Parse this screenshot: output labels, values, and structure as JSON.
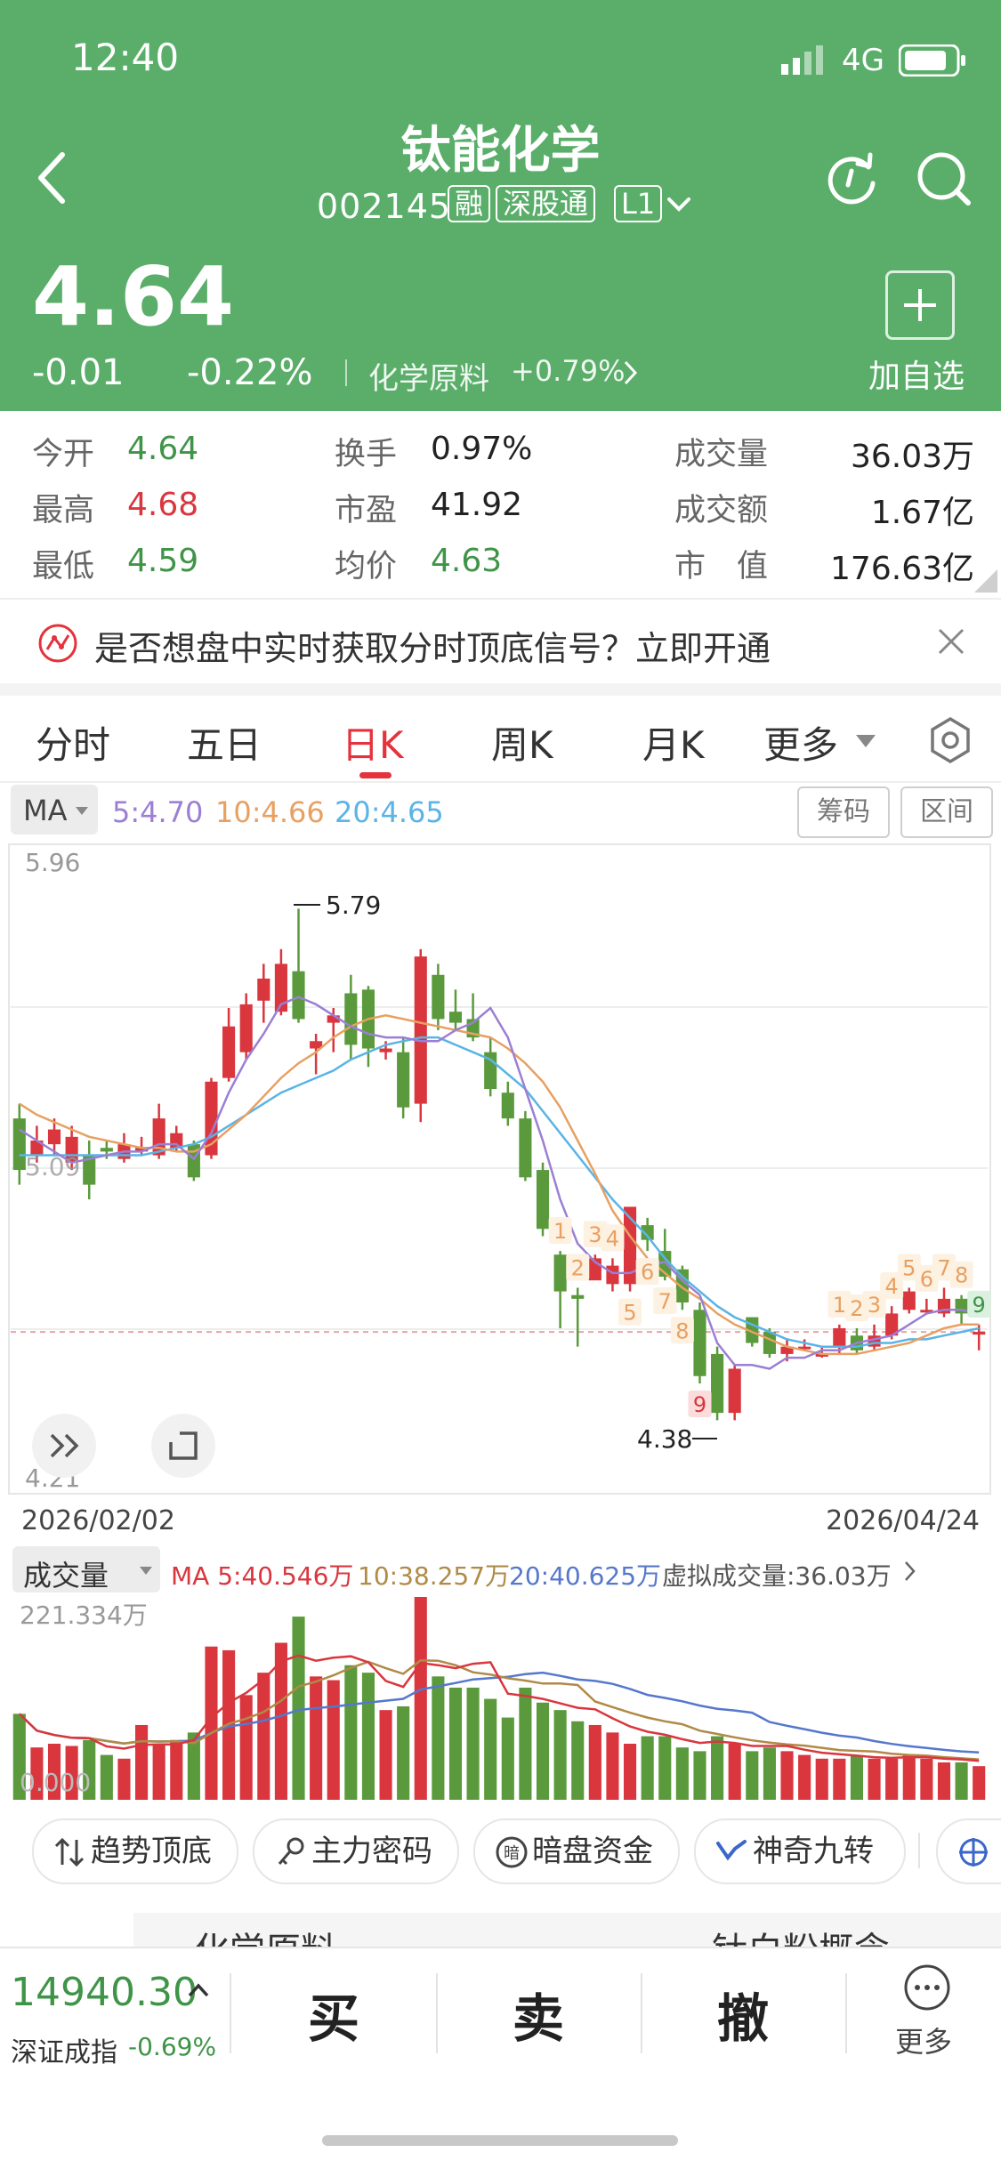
{
  "status_bar": {
    "time": "12:40",
    "network": "4G"
  },
  "stock": {
    "name": "钛能化学",
    "code": "002145",
    "tags": [
      "融",
      "深股通",
      "L1"
    ],
    "price": "4.64",
    "change": "-0.01",
    "change_pct": "-0.22%",
    "sector_name": "化学原料",
    "sector_change": "+0.79%",
    "add_watch_label": "加自选"
  },
  "stats": [
    {
      "label": "今开",
      "value": "4.64"
    },
    {
      "label": "换手",
      "value": "0.97%"
    },
    {
      "label": "成交量",
      "value": "36.03万"
    },
    {
      "label": "最高",
      "value": "4.68"
    },
    {
      "label": "市盈",
      "value": "41.92"
    },
    {
      "label": "成交额",
      "value": "1.67亿"
    },
    {
      "label": "最低",
      "value": "4.59"
    },
    {
      "label": "均价",
      "value": "4.63"
    },
    {
      "label": "市　值",
      "value": "176.63亿"
    }
  ],
  "banner": {
    "text": "是否想盘中实时获取分时顶底信号？立即开通"
  },
  "tabs": [
    "分时",
    "五日",
    "日K",
    "周K",
    "月K",
    "更多"
  ],
  "active_tab": "日K",
  "ma_legend": {
    "selector": "MA",
    "ma5": "5:4.70",
    "ma10": "10:4.66",
    "ma20": "20:4.65",
    "chip_btn": "筹码",
    "range_btn": "区间"
  },
  "colors": {
    "up": "#d9363e",
    "down": "#5b9a3c",
    "header_bg": "#5aae6a",
    "ma5": "#9b7fd4",
    "ma10": "#e8a062",
    "ma20": "#5ab4e6"
  },
  "chart_data": {
    "type": "candlestick",
    "ylim": [
      4.21,
      5.96
    ],
    "date_start": "2026/02/02",
    "date_end": "2026/04/24",
    "y_top_label": "5.96",
    "y_bottom_label": "4.21",
    "left_label": "5.09",
    "high_label": "5.79",
    "low_label": "4.38",
    "candles": [
      [
        5.22,
        5.08,
        5.26,
        5.04
      ],
      [
        5.12,
        5.16,
        5.2,
        5.1
      ],
      [
        5.15,
        5.19,
        5.22,
        5.12
      ],
      [
        5.1,
        5.17,
        5.2,
        5.08
      ],
      [
        5.12,
        5.04,
        5.16,
        5.0
      ],
      [
        5.14,
        5.13,
        5.16,
        5.11
      ],
      [
        5.11,
        5.15,
        5.18,
        5.1
      ],
      [
        5.13,
        5.14,
        5.17,
        5.12
      ],
      [
        5.12,
        5.22,
        5.26,
        5.11
      ],
      [
        5.14,
        5.18,
        5.2,
        5.13
      ],
      [
        5.15,
        5.06,
        5.16,
        5.05
      ],
      [
        5.12,
        5.32,
        5.33,
        5.11
      ],
      [
        5.33,
        5.47,
        5.52,
        5.32
      ],
      [
        5.4,
        5.53,
        5.56,
        5.38
      ],
      [
        5.54,
        5.6,
        5.64,
        5.48
      ],
      [
        5.51,
        5.64,
        5.68,
        5.5
      ],
      [
        5.62,
        5.49,
        5.79,
        5.48
      ],
      [
        5.41,
        5.43,
        5.45,
        5.34
      ],
      [
        5.48,
        5.5,
        5.52,
        5.4
      ],
      [
        5.56,
        5.42,
        5.61,
        5.38
      ],
      [
        5.57,
        5.41,
        5.58,
        5.36
      ],
      [
        5.4,
        5.41,
        5.43,
        5.38
      ],
      [
        5.4,
        5.25,
        5.44,
        5.22
      ],
      [
        5.26,
        5.66,
        5.68,
        5.21
      ],
      [
        5.61,
        5.49,
        5.64,
        5.46
      ],
      [
        5.51,
        5.48,
        5.57,
        5.46
      ],
      [
        5.49,
        5.44,
        5.56,
        5.43
      ],
      [
        5.4,
        5.3,
        5.44,
        5.28
      ],
      [
        5.29,
        5.22,
        5.32,
        5.2
      ],
      [
        5.22,
        5.06,
        5.24,
        5.05
      ],
      [
        5.08,
        4.92,
        5.1,
        4.9
      ],
      [
        4.85,
        4.75,
        4.86,
        4.65
      ],
      [
        4.74,
        4.73,
        4.76,
        4.6
      ],
      [
        4.78,
        4.84,
        4.85,
        4.79
      ],
      [
        4.77,
        4.82,
        4.84,
        4.75
      ],
      [
        4.77,
        4.98,
        4.98,
        4.75
      ],
      [
        4.93,
        4.89,
        4.95,
        4.86
      ],
      [
        4.86,
        4.79,
        4.92,
        4.78
      ],
      [
        4.81,
        4.72,
        4.82,
        4.7
      ],
      [
        4.7,
        4.52,
        4.72,
        4.5
      ],
      [
        4.58,
        4.42,
        4.6,
        4.4
      ],
      [
        4.42,
        4.54,
        4.55,
        4.4
      ],
      [
        4.68,
        4.61,
        4.68,
        4.6
      ],
      [
        4.64,
        4.58,
        4.65,
        4.57
      ],
      [
        4.58,
        4.6,
        4.62,
        4.56
      ],
      [
        4.6,
        4.6,
        4.62,
        4.59
      ],
      [
        4.58,
        4.58,
        4.6,
        4.57
      ],
      [
        4.6,
        4.65,
        4.66,
        4.58
      ],
      [
        4.63,
        4.59,
        4.65,
        4.58
      ],
      [
        4.6,
        4.63,
        4.66,
        4.59
      ],
      [
        4.63,
        4.69,
        4.71,
        4.62
      ],
      [
        4.7,
        4.75,
        4.76,
        4.69
      ],
      [
        4.7,
        4.7,
        4.73,
        4.69
      ],
      [
        4.69,
        4.73,
        4.76,
        4.68
      ],
      [
        4.73,
        4.69,
        4.74,
        4.66
      ],
      [
        4.64,
        4.64,
        4.66,
        4.59
      ]
    ],
    "ma5": [
      5.19,
      5.16,
      5.13,
      5.1,
      5.11,
      5.12,
      5.13,
      5.13,
      5.15,
      5.15,
      5.11,
      5.18,
      5.29,
      5.38,
      5.45,
      5.53,
      5.55,
      5.53,
      5.5,
      5.47,
      5.45,
      5.44,
      5.44,
      5.43,
      5.43,
      5.46,
      5.48,
      5.52,
      5.44,
      5.3,
      5.16,
      5.0,
      4.88,
      4.83,
      4.8,
      4.8,
      4.82,
      4.83,
      4.78,
      4.74,
      4.61,
      4.55,
      4.55,
      4.54,
      4.57,
      4.57,
      4.59,
      4.59,
      4.61,
      4.62,
      4.63,
      4.66,
      4.69,
      4.7,
      4.7,
      4.69
    ],
    "ma10": [
      5.26,
      5.23,
      5.21,
      5.19,
      5.17,
      5.16,
      5.15,
      5.14,
      5.14,
      5.13,
      5.13,
      5.15,
      5.19,
      5.23,
      5.28,
      5.33,
      5.37,
      5.4,
      5.44,
      5.47,
      5.49,
      5.5,
      5.49,
      5.48,
      5.47,
      5.46,
      5.45,
      5.44,
      5.41,
      5.37,
      5.32,
      5.25,
      5.16,
      5.07,
      4.97,
      4.9,
      4.84,
      4.8,
      4.76,
      4.73,
      4.69,
      4.66,
      4.64,
      4.62,
      4.6,
      4.59,
      4.58,
      4.58,
      4.58,
      4.59,
      4.6,
      4.61,
      4.63,
      4.65,
      4.66,
      4.66
    ],
    "ma20": [
      5.12,
      5.12,
      5.12,
      5.12,
      5.12,
      5.12,
      5.12,
      5.12,
      5.13,
      5.14,
      5.15,
      5.17,
      5.2,
      5.23,
      5.26,
      5.29,
      5.31,
      5.33,
      5.35,
      5.38,
      5.4,
      5.42,
      5.43,
      5.44,
      5.44,
      5.42,
      5.4,
      5.38,
      5.34,
      5.3,
      5.24,
      5.18,
      5.12,
      5.06,
      5.0,
      4.95,
      4.9,
      4.84,
      4.79,
      4.75,
      4.71,
      4.68,
      4.66,
      4.64,
      4.62,
      4.61,
      4.6,
      4.6,
      4.6,
      4.61,
      4.61,
      4.62,
      4.62,
      4.63,
      4.64,
      4.65
    ],
    "nine_turn": [
      {
        "i": 31,
        "label": "1",
        "pos": "above"
      },
      {
        "i": 32,
        "label": "2",
        "pos": "above"
      },
      {
        "i": 33,
        "label": "3",
        "pos": "above"
      },
      {
        "i": 34,
        "label": "4",
        "pos": "above"
      },
      {
        "i": 35,
        "label": "5",
        "pos": "below"
      },
      {
        "i": 36,
        "label": "6",
        "pos": "below"
      },
      {
        "i": 37,
        "label": "7",
        "pos": "below"
      },
      {
        "i": 38,
        "label": "8",
        "pos": "below"
      },
      {
        "i": 39,
        "label": "9",
        "pos": "below"
      },
      {
        "i": 47,
        "label": "1",
        "pos": "above"
      },
      {
        "i": 48,
        "label": "2",
        "pos": "above"
      },
      {
        "i": 49,
        "label": "3",
        "pos": "above"
      },
      {
        "i": 50,
        "label": "4",
        "pos": "above"
      },
      {
        "i": 51,
        "label": "5",
        "pos": "above"
      },
      {
        "i": 52,
        "label": "6",
        "pos": "above"
      },
      {
        "i": 53,
        "label": "7",
        "pos": "above"
      },
      {
        "i": 54,
        "label": "8",
        "pos": "above"
      },
      {
        "i": 55,
        "label": "9",
        "pos": "above"
      }
    ],
    "volume": {
      "ymax": 221.334,
      "max_label": "221.334万",
      "zero_label": "0.000",
      "values": [
        115,
        70,
        75,
        72,
        80,
        60,
        55,
        100,
        75,
        80,
        90,
        205,
        200,
        140,
        170,
        210,
        245,
        165,
        160,
        180,
        170,
        120,
        125,
        320,
        165,
        150,
        150,
        135,
        110,
        150,
        130,
        120,
        105,
        100,
        90,
        75,
        85,
        85,
        70,
        65,
        85,
        75,
        65,
        70,
        65,
        60,
        55,
        55,
        60,
        55,
        55,
        60,
        55,
        50,
        50,
        45
      ]
    },
    "volume_legend": {
      "title": "成交量",
      "ma5": "MA 5:40.546万",
      "ma10": "10:38.257万",
      "ma20": "20:40.625万",
      "virtual": "虚拟成交量:36.03万"
    }
  },
  "indicator_chips": [
    "趋势顶底",
    "主力密码",
    "暗盘资金",
    "神奇九转"
  ],
  "partial_row": [
    "化学原料",
    "钛白粉概念"
  ],
  "bottom_bar": {
    "index_value": "14940.30",
    "index_name": "深证成指",
    "index_change": "-0.69%",
    "buy": "买",
    "sell": "卖",
    "cancel": "撤",
    "more": "更多"
  }
}
